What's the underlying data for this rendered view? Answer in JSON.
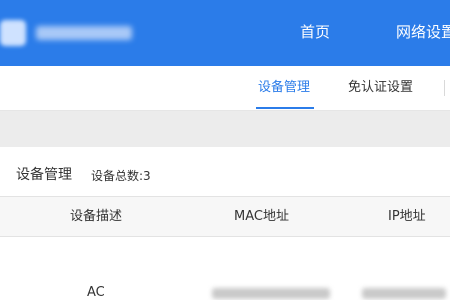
{
  "header": {
    "nav": {
      "home_label": "首页",
      "network_label": "网络设置"
    }
  },
  "subnav": {
    "tabs": [
      {
        "label": "设备管理",
        "active": true
      },
      {
        "label": "免认证设置",
        "active": false
      }
    ]
  },
  "panel": {
    "title": "设备管理",
    "device_count": "设备总数:3"
  },
  "table": {
    "columns": [
      "设备描述",
      "MAC地址",
      "IP地址"
    ],
    "rows": [
      {
        "description": "AC"
      }
    ]
  },
  "colors": {
    "accent": "#2b7ce9",
    "header_bg": "#2b7ce9",
    "strip_bg": "#ececec",
    "table_head_bg": "#f7f7f7"
  }
}
